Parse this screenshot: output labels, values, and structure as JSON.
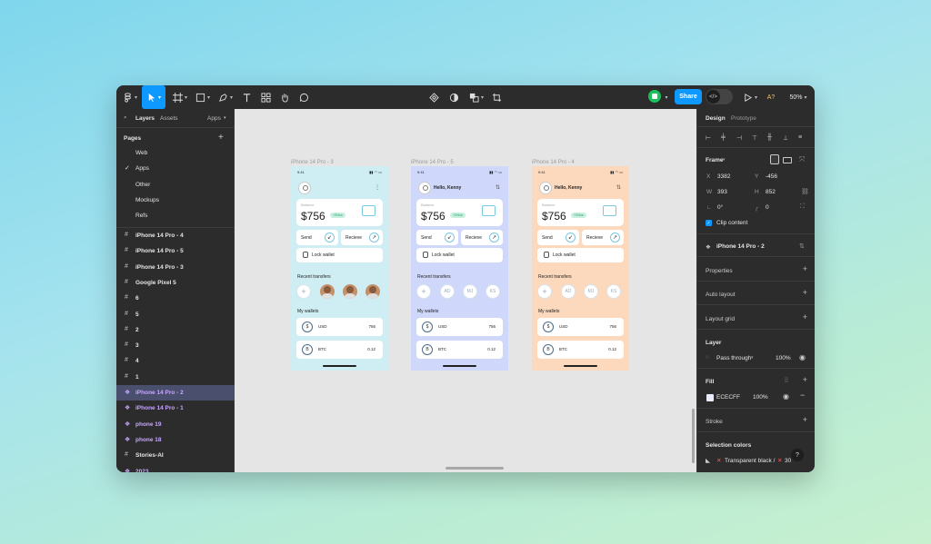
{
  "toolbar": {
    "zoom": "50%",
    "share_label": "Share",
    "access_label": "A?"
  },
  "left_panel": {
    "tab_layers": "Layers",
    "tab_assets": "Assets",
    "tab_apps": "Apps",
    "pages_title": "Pages",
    "pages": [
      "Web",
      "Apps",
      "Other",
      "Mockups",
      "Refs"
    ],
    "current_page": "Apps",
    "layers": [
      {
        "label": "iPhone 14 Pro - 4",
        "type": "frame"
      },
      {
        "label": "iPhone 14 Pro - 5",
        "type": "frame"
      },
      {
        "label": "iPhone 14 Pro - 3",
        "type": "frame"
      },
      {
        "label": "Google Pixel 5",
        "type": "frame"
      },
      {
        "label": "6",
        "type": "frame"
      },
      {
        "label": "5",
        "type": "frame"
      },
      {
        "label": "2",
        "type": "frame"
      },
      {
        "label": "3",
        "type": "frame"
      },
      {
        "label": "4",
        "type": "frame"
      },
      {
        "label": "1",
        "type": "frame"
      },
      {
        "label": "iPhone 14 Pro - 2",
        "type": "component",
        "selected": true
      },
      {
        "label": "iPhone 14 Pro - 1",
        "type": "component"
      },
      {
        "label": "phone 19",
        "type": "component"
      },
      {
        "label": "phone 18",
        "type": "component"
      },
      {
        "label": "Stories-AI",
        "type": "frame"
      },
      {
        "label": "2023",
        "type": "component"
      }
    ]
  },
  "canvas": {
    "frames": [
      {
        "label": "iPhone 14 Pro - 3",
        "bg": "#cfeef3",
        "hello": "",
        "show_faces": true
      },
      {
        "label": "iPhone 14 Pro - 5",
        "bg": "#cfd8fb",
        "hello": "Hello, Kenny",
        "show_faces": false
      },
      {
        "label": "iPhone 14 Pro - 4",
        "bg": "#fcd9bd",
        "hello": "Hello, Kenny",
        "show_faces": false
      }
    ],
    "phone": {
      "time": "9:41",
      "balance_caption": "Balance",
      "balance": "$756",
      "change": "+3%/w",
      "send": "Send",
      "receive": "Recieve",
      "lock": "Lock wallet",
      "recent": "Recent transfers",
      "contacts": [
        "AD",
        "MJ",
        "KS"
      ],
      "my_wallets": "My wallets",
      "wallets": [
        {
          "code": "USD",
          "symbol": "$",
          "value": "756"
        },
        {
          "code": "BTC",
          "symbol": "B",
          "value": "0.12"
        }
      ]
    }
  },
  "right_panel": {
    "tab_design": "Design",
    "tab_prototype": "Prototype",
    "frame_title": "Frame",
    "x_label": "X",
    "x_value": "3382",
    "y_label": "Y",
    "y_value": "-456",
    "w_label": "W",
    "w_value": "393",
    "h_label": "H",
    "h_value": "852",
    "rotation": "0°",
    "radius": "0",
    "clip_content": "Clip content",
    "component_name": "iPhone 14 Pro - 2",
    "properties": "Properties",
    "auto_layout": "Auto layout",
    "layout_grid": "Layout grid",
    "layer_title": "Layer",
    "blend_mode": "Pass through",
    "layer_opacity": "100%",
    "fill_title": "Fill",
    "fill_hex": "ECECFF",
    "fill_opacity": "100%",
    "stroke": "Stroke",
    "selection_colors": "Selection colors",
    "selection_color_1": "Transparent black /",
    "selection_color_2": "30"
  }
}
